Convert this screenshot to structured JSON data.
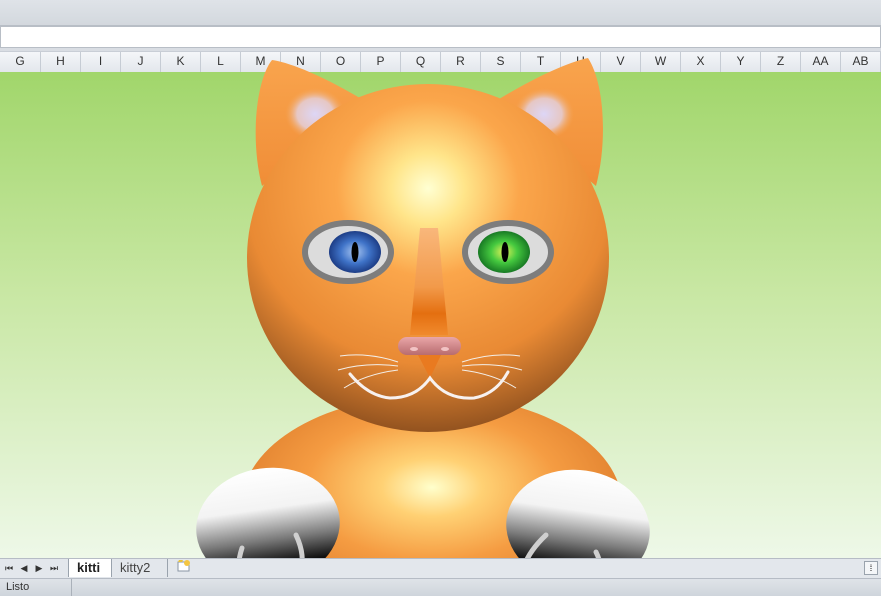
{
  "columns": [
    "G",
    "H",
    "I",
    "J",
    "K",
    "L",
    "M",
    "N",
    "O",
    "P",
    "Q",
    "R",
    "S",
    "T",
    "U",
    "V",
    "W",
    "X",
    "Y",
    "Z",
    "AA",
    "AB"
  ],
  "sheet_tabs": {
    "active": "kitti",
    "other": "kitty2"
  },
  "status": {
    "text": "Listo"
  },
  "nav": {
    "first": "⏮",
    "prev": "◀",
    "next": "▶",
    "last": "⏭",
    "insert_icon": "new-sheet-icon"
  },
  "colors": {
    "background_top": "#a1d66b",
    "background_bottom": "#eef8e8",
    "fur": "#f5993f",
    "eye_left": "#3b6fc4",
    "eye_right": "#35c43a"
  }
}
